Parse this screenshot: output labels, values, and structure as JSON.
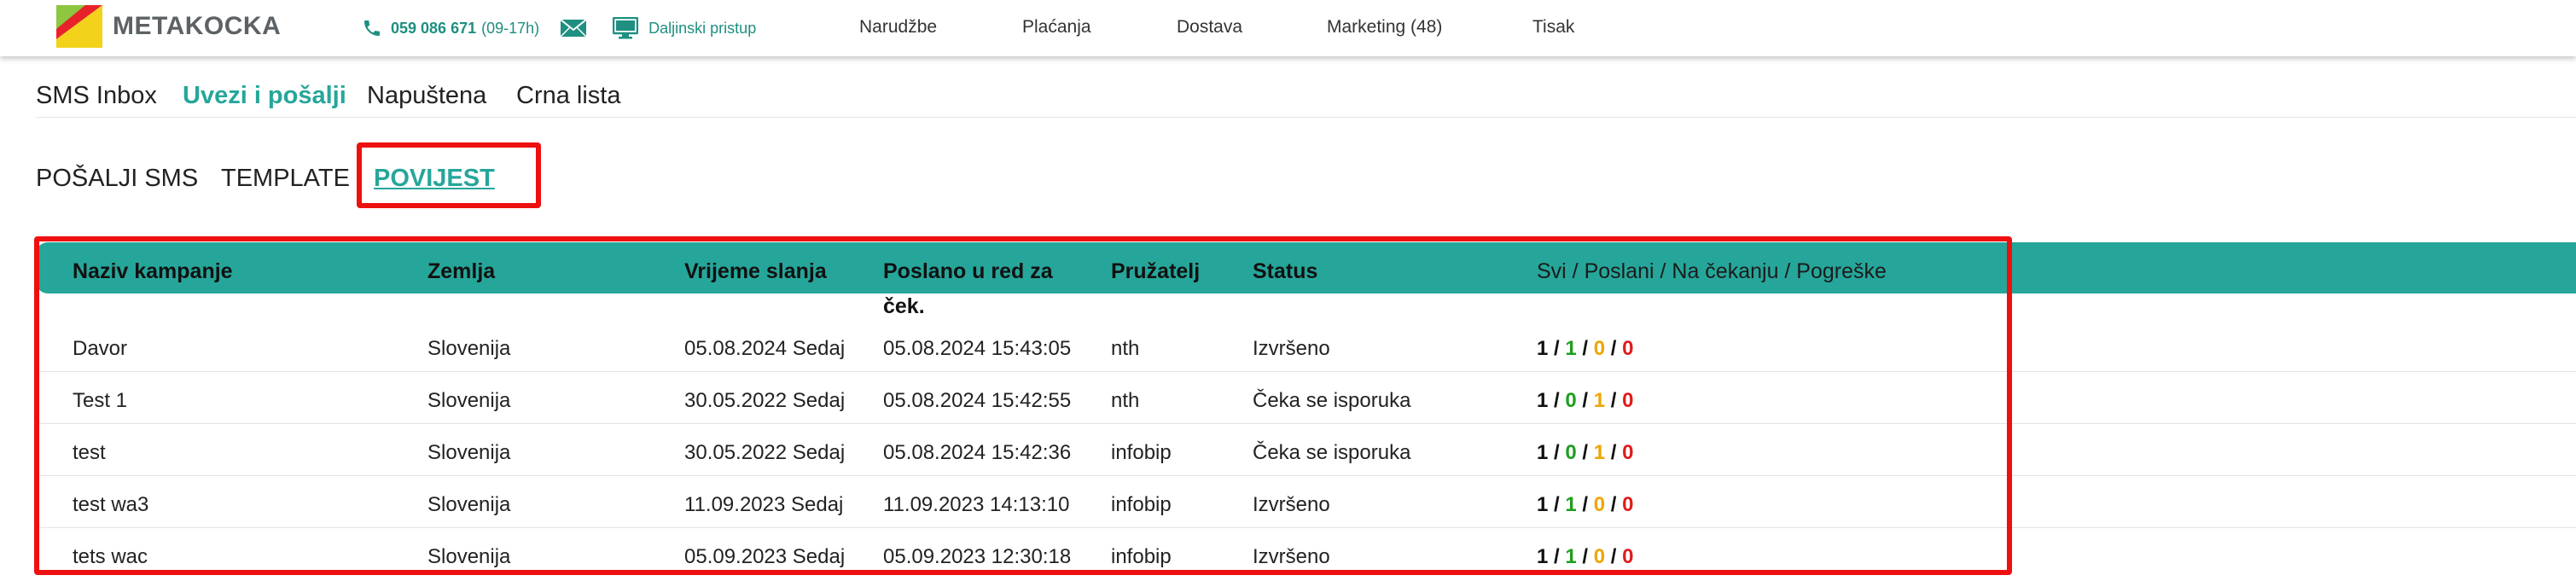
{
  "header": {
    "logo_text": "METAKOCKA",
    "phone": "059 086 671",
    "phone_hours": "(09-17h)",
    "remote_access": "Daljinski pristup",
    "nav": [
      "Narudžbe",
      "Plaćanja",
      "Dostava",
      "Marketing (48)",
      "Tisak"
    ]
  },
  "tabs_primary": [
    "SMS Inbox",
    "Uvezi i pošalji",
    "Napuštena",
    "Crna lista"
  ],
  "tabs_primary_active": "Uvezi i pošalji",
  "tabs_secondary": [
    "POŠALJI SMS",
    "TEMPLATE",
    "POVIJEST"
  ],
  "tabs_secondary_active": "POVIJEST",
  "table": {
    "columns": [
      "Naziv kampanje",
      "Zemlja",
      "Vrijeme slanja",
      "Poslano u red za ček.",
      "Pružatelj",
      "Status",
      "Svi / Poslani / Na čekanju / Pogreške"
    ],
    "rows": [
      {
        "name": "Davor",
        "country": "Slovenija",
        "send_time": "05.08.2024 Sedaj",
        "queued": "05.08.2024 15:43:05",
        "provider": "nth",
        "status": "Izvršeno",
        "all": "1",
        "sent": "1",
        "pending": "0",
        "errors": "0"
      },
      {
        "name": "Test 1",
        "country": "Slovenija",
        "send_time": "30.05.2022 Sedaj",
        "queued": "05.08.2024 15:42:55",
        "provider": "nth",
        "status": "Čeka se isporuka",
        "all": "1",
        "sent": "0",
        "pending": "1",
        "errors": "0"
      },
      {
        "name": "test",
        "country": "Slovenija",
        "send_time": "30.05.2022 Sedaj",
        "queued": "05.08.2024 15:42:36",
        "provider": "infobip",
        "status": "Čeka se isporuka",
        "all": "1",
        "sent": "0",
        "pending": "1",
        "errors": "0"
      },
      {
        "name": "test wa3",
        "country": "Slovenija",
        "send_time": "11.09.2023 Sedaj",
        "queued": "11.09.2023 14:13:10",
        "provider": "infobip",
        "status": "Izvršeno",
        "all": "1",
        "sent": "1",
        "pending": "0",
        "errors": "0"
      },
      {
        "name": "tets wac",
        "country": "Slovenija",
        "send_time": "05.09.2023 Sedaj",
        "queued": "05.09.2023 12:30:18",
        "provider": "infobip",
        "status": "Izvršeno",
        "all": "1",
        "sent": "1",
        "pending": "0",
        "errors": "0"
      }
    ]
  },
  "colors": {
    "accent": "#26a69a",
    "highlight": "#ee0f0f",
    "sent": "#1f9e1f",
    "pending": "#f0a500",
    "error": "#e01b1b"
  },
  "icons": [
    "phone-icon",
    "mail-icon",
    "monitor-icon"
  ]
}
